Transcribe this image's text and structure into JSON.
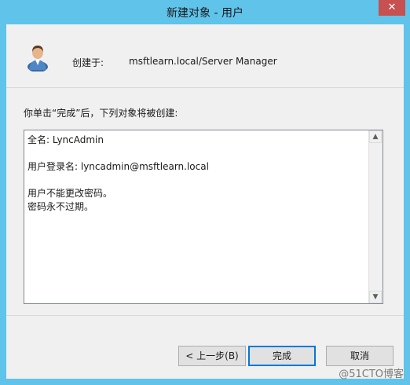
{
  "window": {
    "title": "新建对象 - 用户",
    "close_glyph": "✕"
  },
  "header": {
    "created_label": "创建于:",
    "created_value": "msftlearn.local/Server Manager"
  },
  "intro_text": "你单击“完成”后，下列对象将被创建:",
  "summary": {
    "lines": [
      "全名: LyncAdmin",
      "",
      "用户登录名: lyncadmin@msftlearn.local",
      "",
      "用户不能更改密码。",
      "密码永不过期。"
    ]
  },
  "scrollbar": {
    "up_glyph": "▲",
    "down_glyph": "▼"
  },
  "buttons": {
    "back": "< 上一步(B)",
    "finish": "完成",
    "cancel": "取消"
  },
  "watermark": "@51CTO博客"
}
